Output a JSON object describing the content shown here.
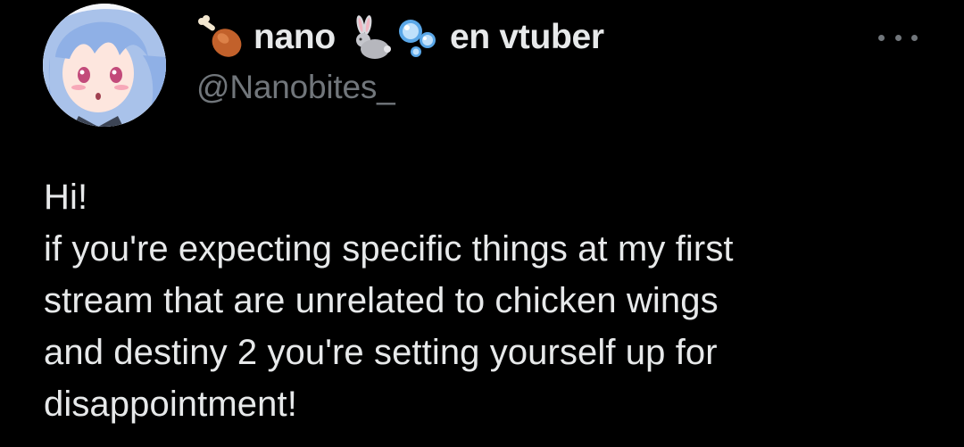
{
  "author": {
    "display_name_part1": "nano",
    "display_name_part2": "en vtuber",
    "handle": "@Nanobites_",
    "name_emojis": [
      "chicken-leg-icon",
      "rabbit-icon",
      "bubbles-icon"
    ]
  },
  "tweet": {
    "lines": [
      "Hi!",
      "if you're expecting specific things at my first",
      "stream that are unrelated to chicken wings",
      "and destiny 2 you're setting yourself up for",
      "disappointment!"
    ]
  },
  "colors": {
    "background": "#000000",
    "primary_text": "#e7e9ea",
    "secondary_text": "#71767b"
  }
}
